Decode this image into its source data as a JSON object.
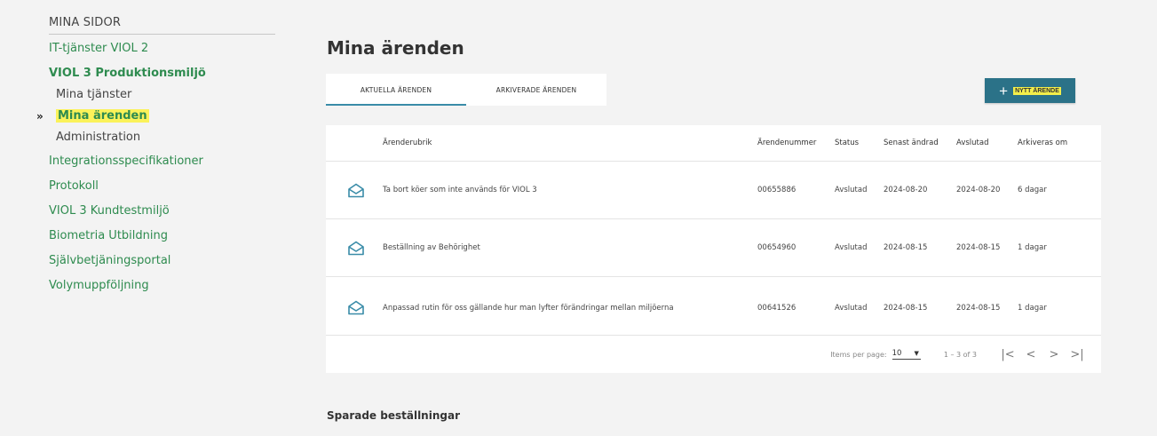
{
  "sidebar": {
    "heading": "MINA SIDOR",
    "items": {
      "it_tjanster": "IT-tjänster VIOL 2",
      "viol3_prod": "VIOL 3 Produktionsmiljö",
      "mina_tjanster": "Mina tjänster",
      "mina_arenden": "Mina ärenden",
      "administration": "Administration",
      "integrationsspec": "Integrationsspecifikationer",
      "protokoll": "Protokoll",
      "viol3_kundtest": "VIOL 3 Kundtestmiljö",
      "biometria": "Biometria Utbildning",
      "sjalvbetjaning": "Självbetjäningsportal",
      "volymuppfoljning": "Volymuppföljning"
    },
    "active_marker": "»"
  },
  "main": {
    "title": "Mina ärenden",
    "tabs": {
      "current": "AKTUELLA ÄRENDEN",
      "archived": "ARKIVERADE ÄRENDEN"
    },
    "new_button": {
      "icon": "+",
      "label": "NYTT ÄRENDE"
    },
    "table": {
      "headers": {
        "subject": "Ärenderubrik",
        "number": "Ärendenummer",
        "status": "Status",
        "changed": "Senast ändrad",
        "closed": "Avslutad",
        "archive": "Arkiveras om"
      },
      "rows": [
        {
          "subject": "Ta bort köer som inte används för VIOL 3",
          "number": "00655886",
          "status": "Avslutad",
          "changed": "2024-08-20",
          "closed": "2024-08-20",
          "archive": "6 dagar"
        },
        {
          "subject": "Beställning av Behörighet",
          "number": "00654960",
          "status": "Avslutad",
          "changed": "2024-08-15",
          "closed": "2024-08-15",
          "archive": "1 dagar"
        },
        {
          "subject": "Anpassad rutin för oss gällande hur man lyfter förändringar mellan miljöerna",
          "number": "00641526",
          "status": "Avslutad",
          "changed": "2024-08-15",
          "closed": "2024-08-15",
          "archive": "1 dagar"
        }
      ],
      "row_icon": "envelope-open-icon"
    },
    "pager": {
      "items_per_page_label": "Items per page:",
      "items_per_page_value": "10",
      "range": "1 – 3 of 3",
      "first": "|<",
      "prev": "<",
      "next": ">",
      "last": ">|"
    },
    "saved_orders_title": "Sparade beställningar"
  },
  "colors": {
    "green_link": "#2e8b4f",
    "teal_button": "#2b7288",
    "tab_underline": "#3a8ca8",
    "highlight": "#fbf25a",
    "icon": "#3a8ca8"
  }
}
